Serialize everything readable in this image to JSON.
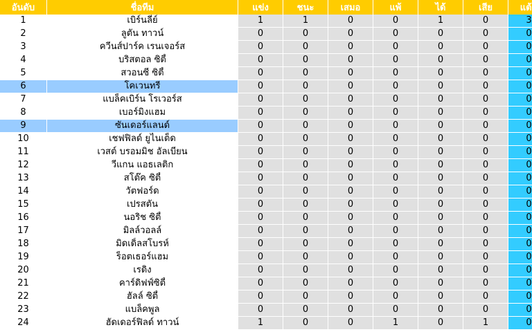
{
  "headers": {
    "rank": "อันดับ",
    "team": "ชื่อทีม",
    "played": "แข่ง",
    "won": "ชนะ",
    "drawn": "เสมอ",
    "lost": "แพ้",
    "gf": "ได้",
    "ga": "เสีย",
    "pts": "แต้ม"
  },
  "rows": [
    {
      "rank": "1",
      "team": "เบิร์นลี่ย์",
      "played": "1",
      "won": "1",
      "drawn": "0",
      "lost": "0",
      "gf": "1",
      "ga": "0",
      "pts": "3",
      "highlight": false
    },
    {
      "rank": "2",
      "team": "ลูตัน ทาวน์",
      "played": "0",
      "won": "0",
      "drawn": "0",
      "lost": "0",
      "gf": "0",
      "ga": "0",
      "pts": "0",
      "highlight": false
    },
    {
      "rank": "3",
      "team": "ควีนส์ปาร์ค เรนเจอร์ส",
      "played": "0",
      "won": "0",
      "drawn": "0",
      "lost": "0",
      "gf": "0",
      "ga": "0",
      "pts": "0",
      "highlight": false
    },
    {
      "rank": "4",
      "team": "บริสตอล ซิตี้",
      "played": "0",
      "won": "0",
      "drawn": "0",
      "lost": "0",
      "gf": "0",
      "ga": "0",
      "pts": "0",
      "highlight": false
    },
    {
      "rank": "5",
      "team": "สวอนซี ซิตี้",
      "played": "0",
      "won": "0",
      "drawn": "0",
      "lost": "0",
      "gf": "0",
      "ga": "0",
      "pts": "0",
      "highlight": false
    },
    {
      "rank": "6",
      "team": "โคเวนทรี",
      "played": "0",
      "won": "0",
      "drawn": "0",
      "lost": "0",
      "gf": "0",
      "ga": "0",
      "pts": "0",
      "highlight": true
    },
    {
      "rank": "7",
      "team": "แบล็คเบิร์น โรเวอร์ส",
      "played": "0",
      "won": "0",
      "drawn": "0",
      "lost": "0",
      "gf": "0",
      "ga": "0",
      "pts": "0",
      "highlight": false
    },
    {
      "rank": "8",
      "team": "เบอร์มิงแฮม",
      "played": "0",
      "won": "0",
      "drawn": "0",
      "lost": "0",
      "gf": "0",
      "ga": "0",
      "pts": "0",
      "highlight": false
    },
    {
      "rank": "9",
      "team": "ซันเดอร์แลนด์",
      "played": "0",
      "won": "0",
      "drawn": "0",
      "lost": "0",
      "gf": "0",
      "ga": "0",
      "pts": "0",
      "highlight": true
    },
    {
      "rank": "10",
      "team": "เชฟฟิลด์ ยูไนเต็ด",
      "played": "0",
      "won": "0",
      "drawn": "0",
      "lost": "0",
      "gf": "0",
      "ga": "0",
      "pts": "0",
      "highlight": false
    },
    {
      "rank": "11",
      "team": "เวสต์ บรอมมิช อัลเบียน",
      "played": "0",
      "won": "0",
      "drawn": "0",
      "lost": "0",
      "gf": "0",
      "ga": "0",
      "pts": "0",
      "highlight": false
    },
    {
      "rank": "12",
      "team": "วีแกน แอธเลติก",
      "played": "0",
      "won": "0",
      "drawn": "0",
      "lost": "0",
      "gf": "0",
      "ga": "0",
      "pts": "0",
      "highlight": false
    },
    {
      "rank": "13",
      "team": "สโต๊ค ซิตี้",
      "played": "0",
      "won": "0",
      "drawn": "0",
      "lost": "0",
      "gf": "0",
      "ga": "0",
      "pts": "0",
      "highlight": false
    },
    {
      "rank": "14",
      "team": "วัตฟอร์ด",
      "played": "0",
      "won": "0",
      "drawn": "0",
      "lost": "0",
      "gf": "0",
      "ga": "0",
      "pts": "0",
      "highlight": false
    },
    {
      "rank": "15",
      "team": "เปรสตัน",
      "played": "0",
      "won": "0",
      "drawn": "0",
      "lost": "0",
      "gf": "0",
      "ga": "0",
      "pts": "0",
      "highlight": false
    },
    {
      "rank": "16",
      "team": "นอริช ซิตี้",
      "played": "0",
      "won": "0",
      "drawn": "0",
      "lost": "0",
      "gf": "0",
      "ga": "0",
      "pts": "0",
      "highlight": false
    },
    {
      "rank": "17",
      "team": "มิลล์วอลล์",
      "played": "0",
      "won": "0",
      "drawn": "0",
      "lost": "0",
      "gf": "0",
      "ga": "0",
      "pts": "0",
      "highlight": false
    },
    {
      "rank": "18",
      "team": "มิดเดิ้ลสโบรห์",
      "played": "0",
      "won": "0",
      "drawn": "0",
      "lost": "0",
      "gf": "0",
      "ga": "0",
      "pts": "0",
      "highlight": false
    },
    {
      "rank": "19",
      "team": "ร็อตเธอร์แฮม",
      "played": "0",
      "won": "0",
      "drawn": "0",
      "lost": "0",
      "gf": "0",
      "ga": "0",
      "pts": "0",
      "highlight": false
    },
    {
      "rank": "20",
      "team": "เรดิง",
      "played": "0",
      "won": "0",
      "drawn": "0",
      "lost": "0",
      "gf": "0",
      "ga": "0",
      "pts": "0",
      "highlight": false
    },
    {
      "rank": "21",
      "team": "คาร์ดิฟฟ์ซิตี้",
      "played": "0",
      "won": "0",
      "drawn": "0",
      "lost": "0",
      "gf": "0",
      "ga": "0",
      "pts": "0",
      "highlight": false
    },
    {
      "rank": "22",
      "team": "ฮัลล์ ซิตี้",
      "played": "0",
      "won": "0",
      "drawn": "0",
      "lost": "0",
      "gf": "0",
      "ga": "0",
      "pts": "0",
      "highlight": false
    },
    {
      "rank": "23",
      "team": "แบล็คพูล",
      "played": "0",
      "won": "0",
      "drawn": "0",
      "lost": "0",
      "gf": "0",
      "ga": "0",
      "pts": "0",
      "highlight": false
    },
    {
      "rank": "24",
      "team": "ฮัดเดอร์ฟิลด์ ทาวน์",
      "played": "1",
      "won": "0",
      "drawn": "0",
      "lost": "1",
      "gf": "0",
      "ga": "1",
      "pts": "0",
      "highlight": false
    }
  ],
  "colors": {
    "header_bg": "#ffcc00",
    "header_text": "#ffffff",
    "stat_bg": "#e0e0e0",
    "points_bg": "#33ccff",
    "highlight_bg": "#99ccff"
  }
}
